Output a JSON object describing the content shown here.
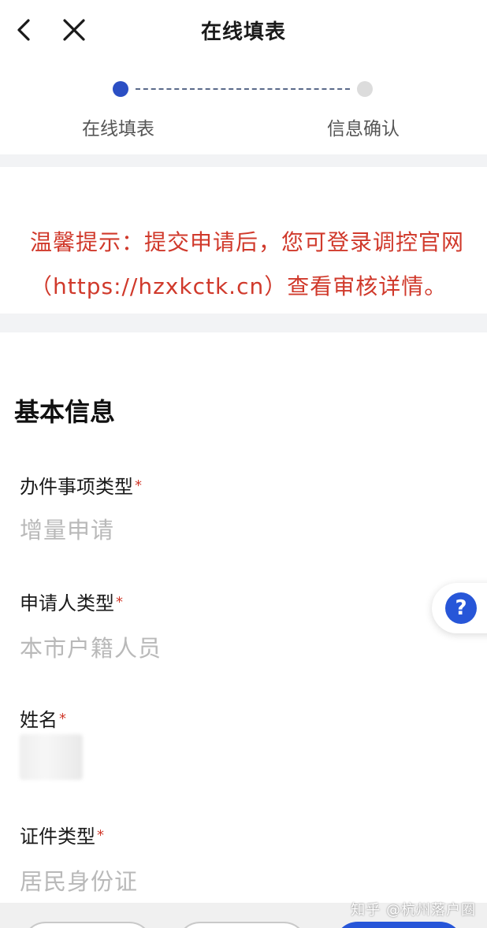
{
  "nav": {
    "title": "在线填表",
    "back_icon": "chevron-left-icon",
    "close_icon": "close-icon"
  },
  "steps": [
    {
      "label": "在线填表",
      "state": "active"
    },
    {
      "label": "信息确认",
      "state": "pending"
    }
  ],
  "notice": {
    "text": "温馨提示：提交申请后，您可登录调控官网（https://hzxkctk.cn）查看审核详情。",
    "color": "#d0392b"
  },
  "form": {
    "section_title": "基本信息",
    "required_mark": "*",
    "fields": [
      {
        "label": "办件事项类型",
        "value": "增量申请"
      },
      {
        "label": "申请人类型",
        "value": "本市户籍人员"
      },
      {
        "label": "姓名",
        "value": ""
      },
      {
        "label": "证件类型",
        "value": "居民身份证"
      }
    ]
  },
  "help": {
    "icon": "question-icon",
    "glyph": "?"
  },
  "watermark": "知乎 @杭州落户圈",
  "colors": {
    "accent": "#2756d8",
    "step_active": "#2b4fc4",
    "warning": "#d0392b",
    "placeholder": "#b9b9b9"
  }
}
